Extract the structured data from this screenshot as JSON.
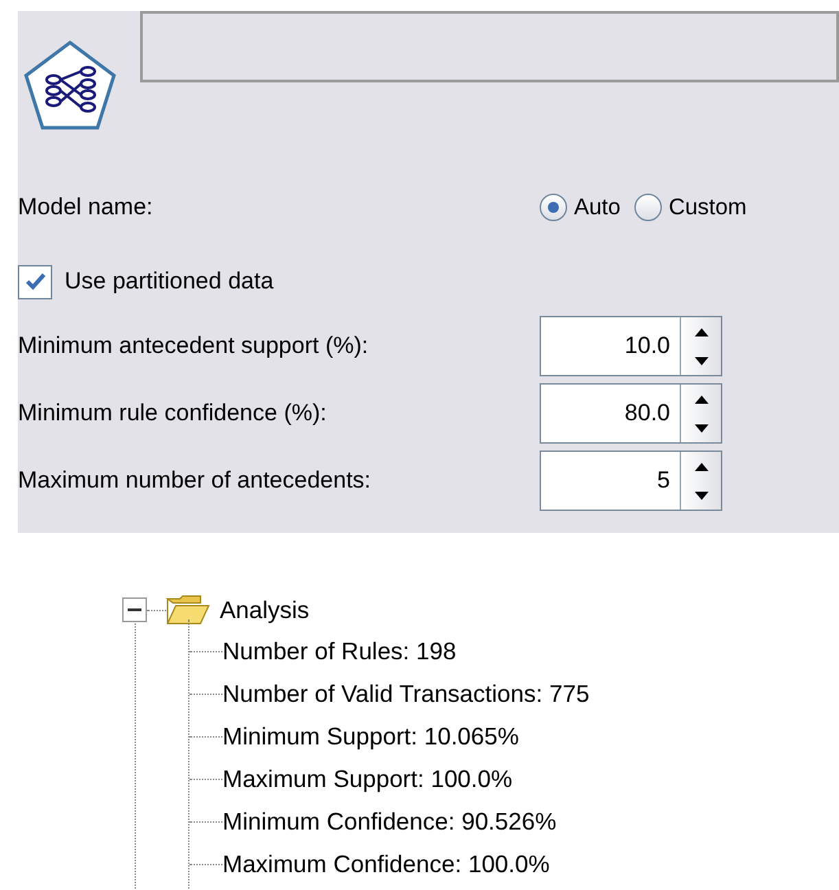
{
  "model_name": {
    "label": "Model name:",
    "options": [
      {
        "label": "Auto",
        "selected": true
      },
      {
        "label": "Custom",
        "selected": false
      }
    ]
  },
  "use_partitioned_data": {
    "label": "Use partitioned data",
    "checked": true
  },
  "settings": [
    {
      "label": "Minimum antecedent support (%):",
      "value": "10.0"
    },
    {
      "label": "Minimum rule confidence (%):",
      "value": "80.0"
    },
    {
      "label": "Maximum number of antecedents:",
      "value": "5"
    }
  ],
  "tree": {
    "label": "Analysis",
    "expanded": true,
    "children": [
      {
        "label": "Number of Rules: 198"
      },
      {
        "label": "Number of Valid Transactions: 775"
      },
      {
        "label": "Minimum Support: 10.065%"
      },
      {
        "label": "Maximum Support: 100.0%"
      },
      {
        "label": "Minimum Confidence: 90.526%"
      },
      {
        "label": "Maximum Confidence: 100.0%"
      }
    ]
  }
}
